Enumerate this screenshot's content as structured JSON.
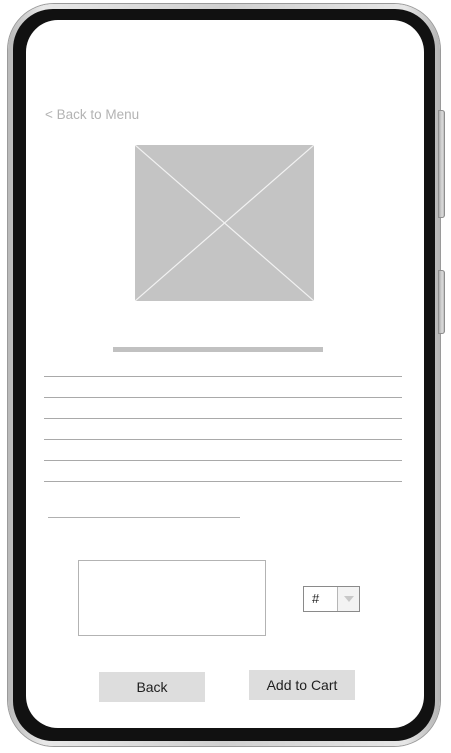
{
  "nav": {
    "back_to_menu_label": "< Back to Menu"
  },
  "product": {
    "image_icon": "image-placeholder-icon"
  },
  "order": {
    "quantity_value": "#",
    "quantity_arrow_icon": "chevron-down-icon"
  },
  "actions": {
    "back_label": "Back",
    "add_to_cart_label": "Add to Cart"
  },
  "colors": {
    "placeholder_gray": "#c4c4c4",
    "button_gray": "#dddddd",
    "muted_text": "#b3b3b3"
  }
}
